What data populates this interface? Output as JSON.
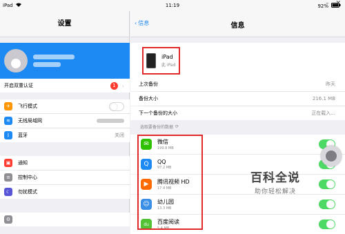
{
  "status": {
    "device": "iPad",
    "time": "11:19",
    "battery": "92%"
  },
  "window": {
    "minimize": "–",
    "close": "✕"
  },
  "left": {
    "title": "设置",
    "two_factor": "开启双重认证",
    "two_factor_badge": "1",
    "items": [
      {
        "label": "飞行模式",
        "icon": "airplane-icon",
        "color": "#ff9500"
      },
      {
        "label": "无线局域网",
        "icon": "wifi-icon",
        "color": "#1d89f3"
      },
      {
        "label": "蓝牙",
        "icon": "bluetooth-icon",
        "color": "#1d89f3",
        "value": "关闭"
      },
      {
        "label": "通知",
        "icon": "notification-icon",
        "color": "#ff3b30"
      },
      {
        "label": "控制中心",
        "icon": "control-center-icon",
        "color": "#8e8e93"
      },
      {
        "label": "勿扰模式",
        "icon": "moon-icon",
        "color": "#5856d6"
      }
    ]
  },
  "right": {
    "back": "信息",
    "title": "信息",
    "device_name": "iPad",
    "device_sub": "此 iPad",
    "rows": [
      {
        "label": "上次备份",
        "value": "昨天"
      },
      {
        "label": "备份大小",
        "value": "216.1 MB"
      },
      {
        "label": "下一个备份的大小",
        "value": "正在载入..."
      }
    ],
    "section": "选取要备份的数据",
    "apps": [
      {
        "name": "微信",
        "size": "199.8 MB",
        "color": "#2dc100",
        "glyph": "✉"
      },
      {
        "name": "QQ",
        "size": "97.2 MB",
        "color": "#1d89f3",
        "glyph": "Q"
      },
      {
        "name": "腾讯视频 HD",
        "size": "17.4 MB",
        "color": "#ff6a00",
        "glyph": "▶"
      },
      {
        "name": "幼儿园",
        "size": "13.3 MB",
        "color": "#3a8ee6",
        "glyph": "☺"
      },
      {
        "name": "百度阅读",
        "size": "5.4 MB",
        "color": "#52c234",
        "glyph": "du"
      }
    ]
  },
  "watermark": {
    "title": "百科全说",
    "sub": "助你轻松解决"
  }
}
